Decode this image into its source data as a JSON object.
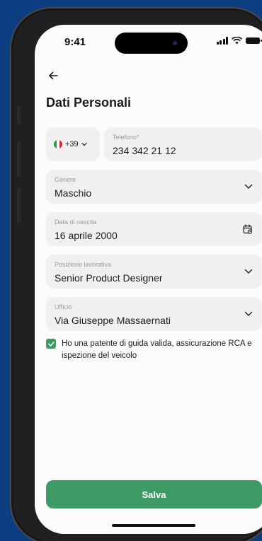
{
  "status_bar": {
    "time": "9:41"
  },
  "header": {
    "title": "Dati Personali"
  },
  "phone": {
    "country_prefix": "+39",
    "label": "Telefono*",
    "value": "234 342 21 12"
  },
  "fields": {
    "gender": {
      "label": "Genere",
      "value": "Maschio"
    },
    "birth_date": {
      "label": "Data di nascita",
      "value": "16 aprile 2000"
    },
    "job_position": {
      "label": "Posizione lavorativa",
      "value": "Senior Product Designer"
    },
    "office": {
      "label": "Ufficio",
      "value": "Via Giuseppe Massaernati"
    }
  },
  "consent": {
    "checked": true,
    "text": "Ho una patente di guida valida, assicurazione RCA e ispezione del veicolo"
  },
  "actions": {
    "save_label": "Salva"
  },
  "colors": {
    "accent": "#3e9a64",
    "background": "#0c3f82",
    "field_bg": "#f0f0f0"
  },
  "icons": [
    "back-arrow-icon",
    "chevron-down-icon",
    "calendar-icon",
    "checkmark-icon",
    "italy-flag-icon",
    "signal-icon",
    "wifi-icon",
    "battery-icon"
  ]
}
